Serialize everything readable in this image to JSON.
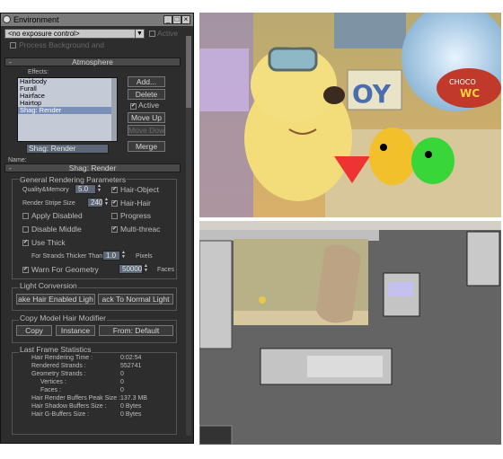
{
  "window": {
    "title": "Environment"
  },
  "exposure": {
    "value": "<no exposure control>",
    "active_label": "Active",
    "process_bg_label": "Process Background and"
  },
  "atmosphere": {
    "header": "Atmosphere",
    "effects_label": "Effects:",
    "effects": [
      "Hairbody",
      "Furall",
      "Hairface",
      "Hairtop",
      "Shag: Render"
    ],
    "selected": "Shag: Render",
    "add": "Add...",
    "delete": "Delete",
    "active": "Active",
    "move_up": "Move Up",
    "move_down": "Move Down",
    "name_label": "Name:",
    "name_value": "Shag: Render",
    "merge": "Merge"
  },
  "shag": {
    "header": "Shag: Render",
    "general_title": "General Rendering Parameters",
    "quality_label": "Quality&Memory",
    "quality_value": "5.0",
    "hair_object": "Hair-Object",
    "stripe_label": "Render Stripe Size",
    "stripe_value": "240",
    "hair_hair": "Hair-Hair",
    "apply_disabled": "Apply Disabled",
    "progress": "Progress",
    "disable_middle": "Disable Middle",
    "multithread": "Multi-threac",
    "use_thick": "Use Thick",
    "strands_label": "For Strands Thicker Than",
    "strands_value": "1.0",
    "pixels": "Pixels",
    "warn_geometry": "Warn For Geometry",
    "faces_value": "50000",
    "faces": "Faces",
    "light_title": "Light Conversion",
    "make_hair_enabled": "ake Hair Enabled Ligh",
    "back_normal": "ack To Normal Light",
    "copy_title": "Copy Model Hair Modifier",
    "copy": "Copy",
    "instance": "Instance",
    "from_default": "From: Default",
    "stats_title": "Last Frame Statistics",
    "stats": [
      {
        "label": "Hair Rendering Time :",
        "value": "0:02:54"
      },
      {
        "label": "Rendered Strands :",
        "value": "552741"
      },
      {
        "label": "Geometry Strands :",
        "value": "0"
      },
      {
        "label": "Vertices :",
        "value": "0"
      },
      {
        "label": "Faces :",
        "value": "0"
      },
      {
        "label": "Hair Render Buffers Peak Size :",
        "value": "137.3 MB"
      },
      {
        "label": "Hair Shadow Buffers Size :",
        "value": "0 Bytes"
      },
      {
        "label": "Hair G-Buffers Size :",
        "value": "0 Bytes"
      }
    ]
  },
  "render_image": {
    "sign_text": "OY",
    "bowl_text": "CHOCO",
    "tag_text": "WC"
  }
}
